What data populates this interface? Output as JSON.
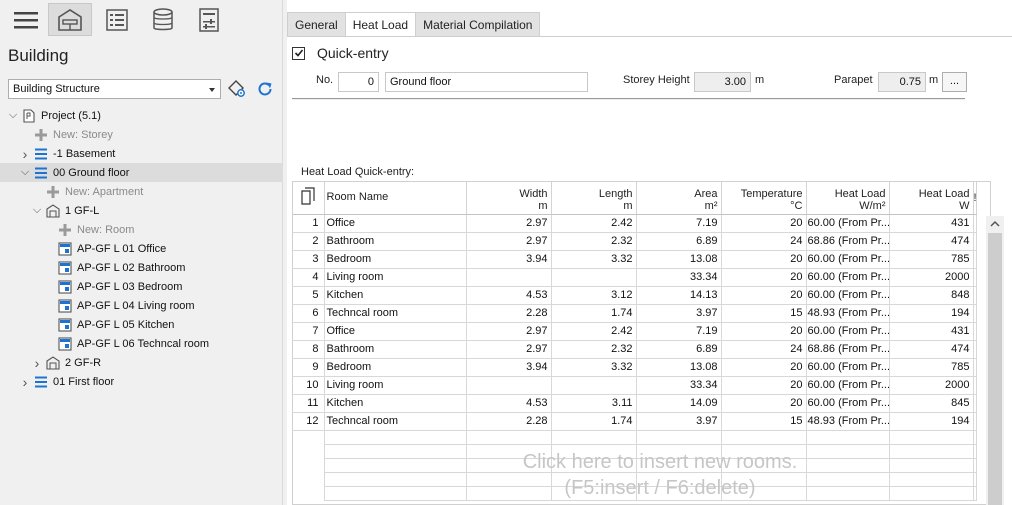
{
  "sidebar": {
    "title": "Building",
    "combo_value": "Building Structure",
    "tree": [
      {
        "label": "Project (5.1)",
        "level": 0,
        "chev": "down",
        "icon": "project-icon"
      },
      {
        "label": "New: Storey",
        "level": 1,
        "icon": "plus-icon",
        "dim": true
      },
      {
        "label": "-1 Basement",
        "level": 1,
        "chev": "right",
        "icon": "storey-icon"
      },
      {
        "label": "00 Ground floor",
        "level": 1,
        "chev": "down",
        "icon": "storey-icon",
        "selected": true
      },
      {
        "label": "New: Apartment",
        "level": 2,
        "icon": "plus-icon",
        "dim": true
      },
      {
        "label": "1 GF-L",
        "level": 2,
        "chev": "down",
        "icon": "apartment-icon"
      },
      {
        "label": "New: Room",
        "level": 3,
        "icon": "plus-icon",
        "dim": true
      },
      {
        "label": "AP-GF L 01 Office",
        "level": 3,
        "icon": "room-icon"
      },
      {
        "label": "AP-GF L 02 Bathroom",
        "level": 3,
        "icon": "room-icon"
      },
      {
        "label": "AP-GF L 03 Bedroom",
        "level": 3,
        "icon": "room-icon"
      },
      {
        "label": "AP-GF L 04 Living room",
        "level": 3,
        "icon": "room-icon"
      },
      {
        "label": "AP-GF L 05 Kitchen",
        "level": 3,
        "icon": "room-icon"
      },
      {
        "label": "AP-GF L 06 Techncal room",
        "level": 3,
        "icon": "room-icon"
      },
      {
        "label": "2 GF-R",
        "level": 2,
        "chev": "right",
        "icon": "apartment-icon"
      },
      {
        "label": "01 First floor",
        "level": 1,
        "chev": "right",
        "icon": "storey-icon"
      }
    ]
  },
  "tabs": [
    {
      "label": "General",
      "active": false
    },
    {
      "label": "Heat Load",
      "active": true
    },
    {
      "label": "Material Compilation",
      "active": false
    }
  ],
  "quick_entry": {
    "label": "Quick-entry",
    "checked": true,
    "no_label": "No.",
    "no_value": "0",
    "name_value": "Ground floor",
    "storey_height_label": "Storey Height",
    "storey_height_value": "3.00",
    "storey_height_unit": "m",
    "parapet_label": "Parapet",
    "parapet_value": "0.75",
    "parapet_unit": "m",
    "more_label": "..."
  },
  "grid": {
    "caption": "Heat Load Quick-entry:",
    "headers": {
      "name": "Room Name",
      "width": "Width",
      "width_unit": "m",
      "length": "Length",
      "length_unit": "m",
      "area": "Area",
      "area_unit": "m²",
      "temp": "Temperature",
      "temp_unit": "°C",
      "heatload_wm": "Heat Load",
      "heatload_wm_unit": "W/m²",
      "heatload_w": "Heat Load",
      "heatload_w_unit": "W",
      "extra": "!"
    },
    "rows": [
      {
        "no": "1",
        "name": "Office",
        "width": "2.97",
        "length": "2.42",
        "area": "7.19",
        "temp": "20",
        "wm": "60.00 (From Pr...",
        "w": "431"
      },
      {
        "no": "2",
        "name": "Bathroom",
        "width": "2.97",
        "length": "2.32",
        "area": "6.89",
        "temp": "24",
        "wm": "68.86 (From Pr...",
        "w": "474"
      },
      {
        "no": "3",
        "name": "Bedroom",
        "width": "3.94",
        "length": "3.32",
        "area": "13.08",
        "temp": "20",
        "wm": "60.00 (From Pr...",
        "w": "785"
      },
      {
        "no": "4",
        "name": "Living room",
        "width": "",
        "length": "",
        "area": "33.34",
        "temp": "20",
        "wm": "60.00 (From Pr...",
        "w": "2000"
      },
      {
        "no": "5",
        "name": "Kitchen",
        "width": "4.53",
        "length": "3.12",
        "area": "14.13",
        "temp": "20",
        "wm": "60.00 (From Pr...",
        "w": "848"
      },
      {
        "no": "6",
        "name": "Techncal room",
        "width": "2.28",
        "length": "1.74",
        "area": "3.97",
        "temp": "15",
        "wm": "48.93 (From Pr...",
        "w": "194"
      },
      {
        "no": "7",
        "name": "Office",
        "width": "2.97",
        "length": "2.42",
        "area": "7.19",
        "temp": "20",
        "wm": "60.00 (From Pr...",
        "w": "431"
      },
      {
        "no": "8",
        "name": "Bathroom",
        "width": "2.97",
        "length": "2.32",
        "area": "6.89",
        "temp": "24",
        "wm": "68.86 (From Pr...",
        "w": "474"
      },
      {
        "no": "9",
        "name": "Bedroom",
        "width": "3.94",
        "length": "3.32",
        "area": "13.08",
        "temp": "20",
        "wm": "60.00 (From Pr...",
        "w": "785"
      },
      {
        "no": "10",
        "name": "Living room",
        "width": "",
        "length": "",
        "area": "33.34",
        "temp": "20",
        "wm": "60.00 (From Pr...",
        "w": "2000"
      },
      {
        "no": "11",
        "name": "Kitchen",
        "width": "4.53",
        "length": "3.11",
        "area": "14.09",
        "temp": "20",
        "wm": "60.00 (From Pr...",
        "w": "845"
      },
      {
        "no": "12",
        "name": "Techncal room",
        "width": "2.28",
        "length": "1.74",
        "area": "3.97",
        "temp": "15",
        "wm": "48.93 (From Pr...",
        "w": "194"
      }
    ],
    "hint_line1": "Click here to insert new rooms.",
    "hint_line2": "(F5:insert / F6:delete)"
  },
  "colors": {
    "accent": "#1e73d2",
    "selected_bg": "#dcdcdc"
  }
}
